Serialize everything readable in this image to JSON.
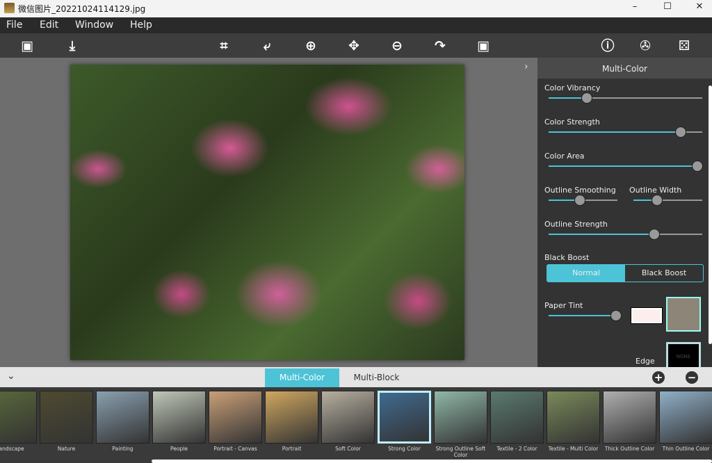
{
  "window": {
    "title": "微信图片_20221024114129.jpg",
    "minimize": "–",
    "maximize": "☐",
    "close": "✕"
  },
  "menu": [
    "File",
    "Edit",
    "Window",
    "Help"
  ],
  "toolbar": [
    {
      "name": "open-image-icon",
      "glyph": "▣"
    },
    {
      "name": "save-icon",
      "glyph": "⤓"
    },
    {
      "name": "crop-icon",
      "glyph": "⌗"
    },
    {
      "name": "rotate-left-icon",
      "glyph": "⤶"
    },
    {
      "name": "zoom-in-icon",
      "glyph": "⊕"
    },
    {
      "name": "pan-icon",
      "glyph": "✥"
    },
    {
      "name": "zoom-out-icon",
      "glyph": "⊖"
    },
    {
      "name": "rotate-right-icon",
      "glyph": "↷"
    },
    {
      "name": "fit-image-icon",
      "glyph": "▣"
    },
    {
      "name": "info-icon",
      "glyph": "ⓘ"
    },
    {
      "name": "settings-icon",
      "glyph": "✇"
    },
    {
      "name": "random-dice-icon",
      "glyph": "⚄"
    }
  ],
  "panel": {
    "title": "Multi-Color",
    "sliders": {
      "color_vibrancy": {
        "label": "Color Vibrancy",
        "value": 25
      },
      "color_strength": {
        "label": "Color Strength",
        "value": 86
      },
      "color_area": {
        "label": "Color Area",
        "value": 97
      },
      "outline_smoothing": {
        "label": "Outline Smoothing",
        "value": 45
      },
      "outline_width": {
        "label": "Outline Width",
        "value": 34
      },
      "outline_strength": {
        "label": "Outline Strength",
        "value": 69
      },
      "paper_tint": {
        "label": "Paper Tint",
        "value": 100
      }
    },
    "black_boost": {
      "label": "Black Boost",
      "options": [
        "Normal",
        "Black Boost"
      ],
      "selected": "Normal"
    },
    "tint_color": "#fdeeee",
    "edge_label": "Edge",
    "edge_thumb_text": "NONE"
  },
  "bottom": {
    "tabs": [
      "Multi-Color",
      "Multi-Block"
    ],
    "active_tab": "Multi-Color",
    "add": "+",
    "remove": "−",
    "presets": [
      {
        "label": "Landscape",
        "color": "#5a6a3a"
      },
      {
        "label": "Nature",
        "color": "#4e4a30"
      },
      {
        "label": "Painting",
        "color": "#8aa0b0"
      },
      {
        "label": "People",
        "color": "#c0c8b8"
      },
      {
        "label": "Portrait - Canvas",
        "color": "#caa078"
      },
      {
        "label": "Portrait",
        "color": "#d0a860"
      },
      {
        "label": "Soft Color",
        "color": "#b8b0a0"
      },
      {
        "label": "Strong Color",
        "color": "#406a90",
        "selected": true
      },
      {
        "label": "Strong Outline Soft Color",
        "color": "#90b8a8"
      },
      {
        "label": "Textile - 2 Color",
        "color": "#5a7a70"
      },
      {
        "label": "Textile - Multi Color",
        "color": "#7a8a5a"
      },
      {
        "label": "Thick Outline Color",
        "color": "#b0b0b0"
      },
      {
        "label": "Thin Outline Color",
        "color": "#90b0c8"
      }
    ]
  },
  "accent": "#4cc3d6"
}
